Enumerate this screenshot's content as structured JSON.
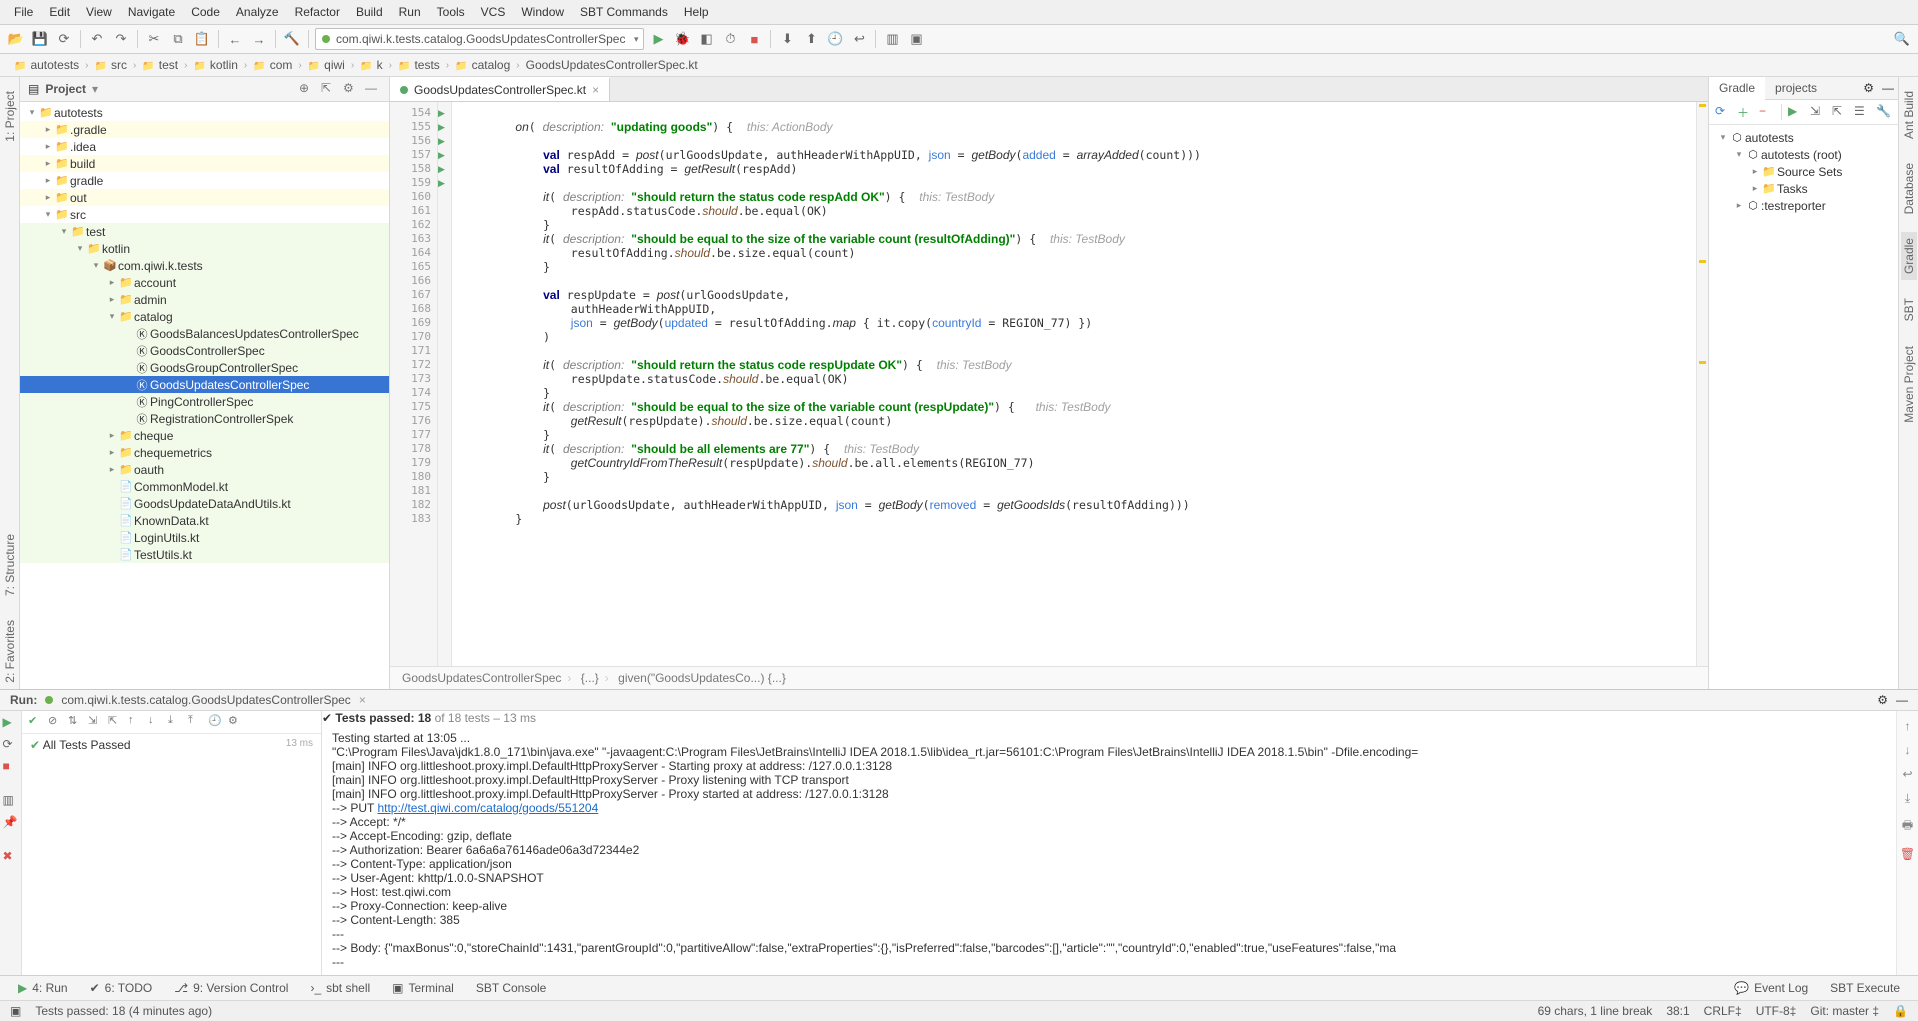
{
  "menu": [
    "File",
    "Edit",
    "View",
    "Navigate",
    "Code",
    "Analyze",
    "Refactor",
    "Build",
    "Run",
    "Tools",
    "VCS",
    "Window",
    "SBT Commands",
    "Help"
  ],
  "runConfig": "com.qiwi.k.tests.catalog.GoodsUpdatesControllerSpec",
  "breadcrumbs": [
    "autotests",
    "src",
    "test",
    "kotlin",
    "com",
    "qiwi",
    "k",
    "tests",
    "catalog",
    "GoodsUpdatesControllerSpec.kt"
  ],
  "leftTabs": [
    "1: Project",
    "2: Favorites",
    "7: Structure"
  ],
  "rightTabs": [
    "Ant Build",
    "Database",
    "Gradle",
    "SBT",
    "Maven Project"
  ],
  "projectPane": {
    "title": "Project"
  },
  "tree": [
    {
      "d": 0,
      "arr": "▾",
      "ic": "📁",
      "txt": "autotests",
      "hl": false
    },
    {
      "d": 1,
      "arr": "▸",
      "ic": "📁",
      "txt": ".gradle",
      "hl": true
    },
    {
      "d": 1,
      "arr": "▸",
      "ic": "📁",
      "txt": ".idea",
      "hl": false
    },
    {
      "d": 1,
      "arr": "▸",
      "ic": "📁",
      "txt": "build",
      "hl": true
    },
    {
      "d": 1,
      "arr": "▸",
      "ic": "📁",
      "txt": "gradle",
      "hl": false
    },
    {
      "d": 1,
      "arr": "▸",
      "ic": "📁",
      "txt": "out",
      "hl": true
    },
    {
      "d": 1,
      "arr": "▾",
      "ic": "📁",
      "txt": "src",
      "hl": false
    },
    {
      "d": 2,
      "arr": "▾",
      "ic": "📁",
      "txt": "test",
      "hl": false,
      "green": true
    },
    {
      "d": 3,
      "arr": "▾",
      "ic": "📁",
      "txt": "kotlin",
      "hl": false,
      "green": true
    },
    {
      "d": 4,
      "arr": "▾",
      "ic": "📦",
      "txt": "com.qiwi.k.tests",
      "hl": false,
      "green": true
    },
    {
      "d": 5,
      "arr": "▸",
      "ic": "📁",
      "txt": "account",
      "hl": false,
      "green": true
    },
    {
      "d": 5,
      "arr": "▸",
      "ic": "📁",
      "txt": "admin",
      "hl": false,
      "green": true
    },
    {
      "d": 5,
      "arr": "▾",
      "ic": "📁",
      "txt": "catalog",
      "hl": false,
      "green": true
    },
    {
      "d": 6,
      "arr": " ",
      "ic": "Ⓚ",
      "txt": "GoodsBalancesUpdatesControllerSpec",
      "hl": false,
      "green": true
    },
    {
      "d": 6,
      "arr": " ",
      "ic": "Ⓚ",
      "txt": "GoodsControllerSpec",
      "hl": false,
      "green": true
    },
    {
      "d": 6,
      "arr": " ",
      "ic": "Ⓚ",
      "txt": "GoodsGroupControllerSpec",
      "hl": false,
      "green": true
    },
    {
      "d": 6,
      "arr": " ",
      "ic": "Ⓚ",
      "txt": "GoodsUpdatesControllerSpec",
      "sel": true,
      "green": true
    },
    {
      "d": 6,
      "arr": " ",
      "ic": "Ⓚ",
      "txt": "PingControllerSpec",
      "hl": false,
      "green": true
    },
    {
      "d": 6,
      "arr": " ",
      "ic": "Ⓚ",
      "txt": "RegistrationControllerSpek",
      "hl": false,
      "green": true
    },
    {
      "d": 5,
      "arr": "▸",
      "ic": "📁",
      "txt": "cheque",
      "hl": false,
      "green": true
    },
    {
      "d": 5,
      "arr": "▸",
      "ic": "📁",
      "txt": "chequemetrics",
      "hl": false,
      "green": true
    },
    {
      "d": 5,
      "arr": "▸",
      "ic": "📁",
      "txt": "oauth",
      "hl": false,
      "green": true
    },
    {
      "d": 5,
      "arr": " ",
      "ic": "📄",
      "txt": "CommonModel.kt",
      "hl": false,
      "green": true
    },
    {
      "d": 5,
      "arr": " ",
      "ic": "📄",
      "txt": "GoodsUpdateDataAndUtils.kt",
      "hl": false,
      "green": true
    },
    {
      "d": 5,
      "arr": " ",
      "ic": "📄",
      "txt": "KnownData.kt",
      "hl": false,
      "green": true
    },
    {
      "d": 5,
      "arr": " ",
      "ic": "📄",
      "txt": "LoginUtils.kt",
      "hl": false,
      "green": true
    },
    {
      "d": 5,
      "arr": " ",
      "ic": "📄",
      "txt": "TestUtils.kt",
      "hl": false,
      "green": true
    }
  ],
  "editor": {
    "tab": "GoodsUpdatesControllerSpec.kt",
    "lineStart": 154,
    "lineEnd": 183,
    "runnable": [
      155,
      160,
      163,
      172,
      175,
      178
    ],
    "statusPath": [
      "GoodsUpdatesControllerSpec",
      "{...}",
      "given(\"GoodsUpdatesCo...) {...}"
    ]
  },
  "gradle": {
    "tabs": [
      "Gradle",
      "projects"
    ],
    "tree": [
      {
        "d": 0,
        "arr": "▾",
        "ic": "⬡",
        "txt": "autotests"
      },
      {
        "d": 1,
        "arr": "▾",
        "ic": "⬡",
        "txt": "autotests (root)"
      },
      {
        "d": 2,
        "arr": "▸",
        "ic": "📁",
        "txt": "Source Sets"
      },
      {
        "d": 2,
        "arr": "▸",
        "ic": "📁",
        "txt": "Tasks"
      },
      {
        "d": 1,
        "arr": "▸",
        "ic": "⬡",
        "txt": ":testreporter"
      }
    ]
  },
  "run": {
    "label": "Run:",
    "config": "com.qiwi.k.tests.catalog.GoodsUpdatesControllerSpec",
    "summary": "Tests passed: 18",
    "summaryRest": " of 18 tests – 13 ms",
    "treeItem": "All Tests Passed",
    "treeMs": "13 ms",
    "output": [
      {
        "t": "Testing started at 13:05 ..."
      },
      {
        "t": "\"C:\\Program Files\\Java\\jdk1.8.0_171\\bin\\java.exe\" \"-javaagent:C:\\Program Files\\JetBrains\\IntelliJ IDEA 2018.1.5\\lib\\idea_rt.jar=56101:C:\\Program Files\\JetBrains\\IntelliJ IDEA 2018.1.5\\bin\" -Dfile.encoding="
      },
      {
        "t": "[main] INFO org.littleshoot.proxy.impl.DefaultHttpProxyServer - Starting proxy at address: /127.0.0.1:3128"
      },
      {
        "t": "[main] INFO org.littleshoot.proxy.impl.DefaultHttpProxyServer - Proxy listening with TCP transport"
      },
      {
        "t": "[main] INFO org.littleshoot.proxy.impl.DefaultHttpProxyServer - Proxy started at address: /127.0.0.1:3128"
      },
      {
        "t": "--> PUT ",
        "url": "http://test.qiwi.com/catalog/goods/551204"
      },
      {
        "t": "--> Accept: */*"
      },
      {
        "t": "--> Accept-Encoding: gzip, deflate"
      },
      {
        "t": "--> Authorization: Bearer 6a6a6a76146ade06a3d72344e2"
      },
      {
        "t": "--> Content-Type: application/json"
      },
      {
        "t": "--> User-Agent: khttp/1.0.0-SNAPSHOT"
      },
      {
        "t": "--> Host: test.qiwi.com"
      },
      {
        "t": "--> Proxy-Connection: keep-alive"
      },
      {
        "t": "--> Content-Length: 385"
      },
      {
        "t": "---"
      },
      {
        "t": "--> Body: {\"maxBonus\":0,\"storeChainId\":1431,\"parentGroupId\":0,\"partitiveAllow\":false,\"extraProperties\":{},\"isPreferred\":false,\"barcodes\":[],\"article\":\"\",\"countryId\":0,\"enabled\":true,\"useFeatures\":false,\"ma"
      },
      {
        "t": "---"
      }
    ]
  },
  "bottomTabs": {
    "run": "4: Run",
    "todo": "6: TODO",
    "vcs": "9: Version Control",
    "sbt": "sbt shell",
    "terminal": "Terminal",
    "sbtc": "SBT Console",
    "eventLog": "Event Log",
    "sbtExec": "SBT Execute"
  },
  "status": {
    "msg": "Tests passed: 18 (4 minutes ago)",
    "chars": "69 chars, 1 line break",
    "pos": "38:1",
    "eol": "CRLF‡",
    "enc": "UTF-8‡",
    "git": "Git: master ‡"
  }
}
